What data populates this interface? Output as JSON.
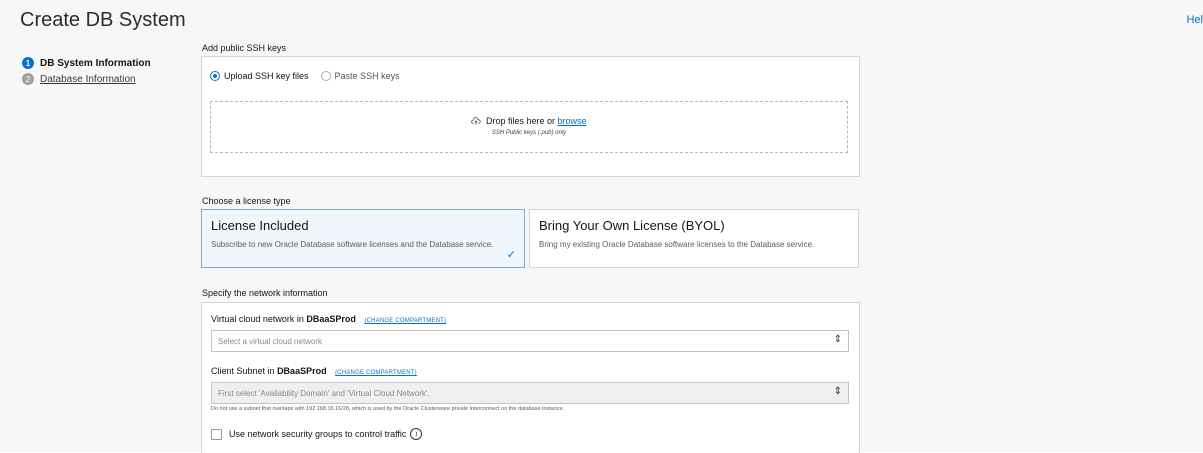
{
  "header": {
    "title": "Create DB System",
    "help_label": "Hel"
  },
  "steps": [
    {
      "number": "1",
      "label": "DB System Information",
      "state": "current"
    },
    {
      "number": "2",
      "label": "Database Information",
      "state": "pending"
    }
  ],
  "ssh": {
    "section_label": "Add public SSH keys",
    "options": [
      {
        "label": "Upload SSH key files",
        "selected": true
      },
      {
        "label": "Paste SSH keys",
        "selected": false
      }
    ],
    "drop_text": "Drop files here or",
    "browse_label": "browse",
    "drop_hint": "SSH Public keys (.pub) only",
    "drop_icon": "cloud-upload-icon"
  },
  "license": {
    "section_label": "Choose a license type",
    "options": [
      {
        "title": "License Included",
        "description": "Subscribe to new Oracle Database software licenses and the Database service.",
        "selected": true
      },
      {
        "title": "Bring Your Own License (BYOL)",
        "description": "Bring my existing Oracle Database software licenses to the Database service.",
        "selected": false
      }
    ],
    "check_icon": "checkmark-icon"
  },
  "network": {
    "section_label": "Specify the network information",
    "vcn": {
      "label_prefix": "Virtual cloud network in",
      "compartment": "DBaaSProd",
      "change_label": "(CHANGE COMPARTMENT)",
      "placeholder": "Select a virtual cloud network"
    },
    "subnet": {
      "label_prefix": "Client Subnet in",
      "compartment": "DBaaSProd",
      "change_label": "(CHANGE COMPARTMENT)",
      "placeholder": "First select 'Availability Domain' and 'Virtual Cloud Network'.",
      "hint": "Do not use a subnet that overlaps with 192.168.16.16/28, which is used by the Oracle Clusterware private interconnect on the database instance."
    },
    "nsg_label": "Use network security groups to control traffic",
    "nsg_checked": false,
    "info_icon": "info-icon"
  },
  "colors": {
    "accent": "#0572ce",
    "selected_card_bg": "#f0f6fb",
    "page_bg": "#f7f7f7"
  }
}
